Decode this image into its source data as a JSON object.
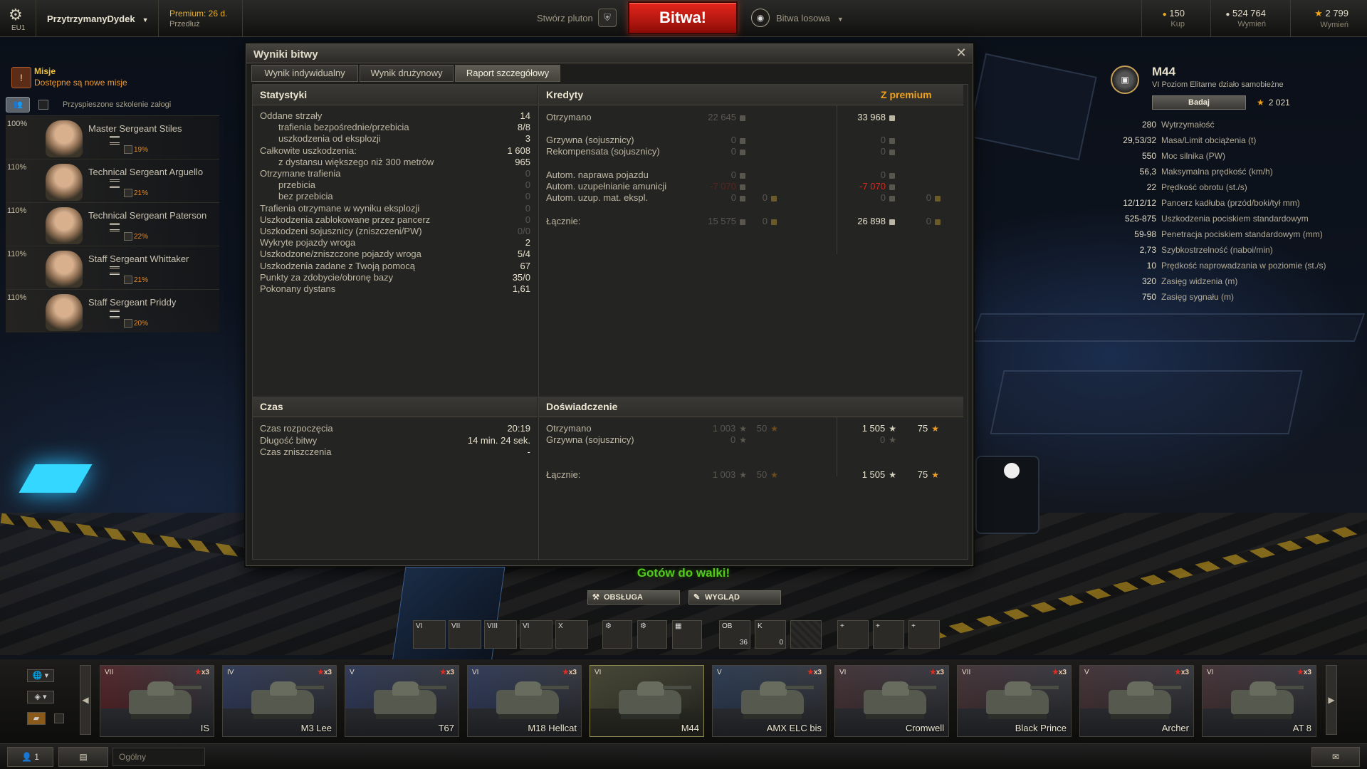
{
  "topbar": {
    "server": "EU1",
    "player_name": "PrzytrzymanyDydek",
    "premium_status": "Premium: 26 d.",
    "premium_extend": "Przedłuż",
    "create_platoon": "Stwórz pluton",
    "battle_button": "Bitwa!",
    "battle_mode": "Bitwa losowa",
    "currencies": [
      {
        "value": "150",
        "action": "Kup",
        "color": "#e8b12f"
      },
      {
        "value": "524 764",
        "action": "Wymień",
        "color": "#d9d3c1"
      },
      {
        "value": "2 799",
        "action": "Wymień",
        "color": "#f0a019"
      }
    ]
  },
  "missions": {
    "title": "Misje",
    "subtitle": "Dostępne są nowe misje"
  },
  "crew_panel": {
    "accelerated_training": "Przyspieszone szkolenie załogi",
    "members": [
      {
        "percent": "100%",
        "name": "Master Sergeant Stiles",
        "skill": "19%"
      },
      {
        "percent": "110%",
        "name": "Technical Sergeant Arguello",
        "skill": "21%"
      },
      {
        "percent": "110%",
        "name": "Technical Sergeant Paterson",
        "skill": "22%"
      },
      {
        "percent": "110%",
        "name": "Staff Sergeant Whittaker",
        "skill": "21%"
      },
      {
        "percent": "110%",
        "name": "Staff Sergeant Priddy",
        "skill": "20%"
      }
    ]
  },
  "vehicle": {
    "name": "M44",
    "type": "VI Poziom Elitarne działo samobieżne",
    "research_label": "Badaj",
    "xp": "2 021",
    "stats": [
      {
        "value": "280",
        "label": "Wytrzymałość"
      },
      {
        "value": "29,53/32",
        "label": "Masa/Limit obciążenia (t)"
      },
      {
        "value": "550",
        "label": "Moc silnika (PW)"
      },
      {
        "value": "56,3",
        "label": "Maksymalna prędkość (km/h)"
      },
      {
        "value": "22",
        "label": "Prędkość obrotu (st./s)"
      },
      {
        "value": "12/12/12",
        "label": "Pancerz kadłuba (przód/boki/tył mm)"
      },
      {
        "value": "525-875",
        "label": "Uszkodzenia pociskiem standardowym"
      },
      {
        "value": "59-98",
        "label": "Penetracja pociskiem standardowym (mm)"
      },
      {
        "value": "2,73",
        "label": "Szybkostrzelność (naboi/min)"
      },
      {
        "value": "10",
        "label": "Prędkość naprowadzania w poziomie (st./s)"
      },
      {
        "value": "320",
        "label": "Zasięg widzenia (m)"
      },
      {
        "value": "750",
        "label": "Zasięg sygnału (m)"
      }
    ]
  },
  "results": {
    "window_title": "Wyniki bitwy",
    "tabs": [
      "Wynik indywidualny",
      "Wynik drużynowy",
      "Raport szczegółowy"
    ],
    "stats": {
      "title": "Statystyki",
      "rows": [
        {
          "label": "Oddane strzały",
          "value": "14",
          "indent": false,
          "dim": false
        },
        {
          "label": "trafienia bezpośrednie/przebicia",
          "value": "8/8",
          "indent": true,
          "dim": false
        },
        {
          "label": "uszkodzenia od eksplozji",
          "value": "3",
          "indent": true,
          "dim": false
        },
        {
          "label": "Całkowite uszkodzenia:",
          "value": "1 608",
          "indent": false,
          "dim": false
        },
        {
          "label": "z dystansu większego niż 300 metrów",
          "value": "965",
          "indent": true,
          "dim": false
        },
        {
          "label": "Otrzymane trafienia",
          "value": "0",
          "indent": false,
          "dim": true
        },
        {
          "label": "przebicia",
          "value": "0",
          "indent": true,
          "dim": true
        },
        {
          "label": "bez przebicia",
          "value": "0",
          "indent": true,
          "dim": true
        },
        {
          "label": "Trafienia otrzymane w wyniku eksplozji",
          "value": "0",
          "indent": false,
          "dim": true
        },
        {
          "label": "Uszkodzenia zablokowane przez pancerz",
          "value": "0",
          "indent": false,
          "dim": true
        },
        {
          "label": "Uszkodzeni sojusznicy (zniszczeni/PW)",
          "value": "0/0",
          "indent": false,
          "dim": true
        },
        {
          "label": "Wykryte pojazdy wroga",
          "value": "2",
          "indent": false,
          "dim": false
        },
        {
          "label": "Uszkodzone/zniszczone pojazdy wroga",
          "value": "5/4",
          "indent": false,
          "dim": false
        },
        {
          "label": "Uszkodzenia zadane z Twoją pomocą",
          "value": "67",
          "indent": false,
          "dim": false
        },
        {
          "label": "Punkty za zdobycie/obronę bazy",
          "value": "35/0",
          "indent": false,
          "dim": false
        },
        {
          "label": "Pokonany dystans",
          "value": "1,61",
          "indent": false,
          "dim": false
        }
      ]
    },
    "credits": {
      "title": "Kredyty",
      "premium_header": "Z premium",
      "rows": [
        {
          "label": "Otrzymano",
          "base": "22 645",
          "bonus": "",
          "prem": "33 968",
          "prem_bonus": "",
          "base_style": "dim",
          "prem_style": "bright"
        },
        {
          "label": "Grzywna (sojusznicy)",
          "base": "0",
          "bonus": "",
          "prem": "0",
          "prem_bonus": "",
          "base_style": "dim",
          "prem_style": "dim"
        },
        {
          "label": "Rekompensata (sojusznicy)",
          "base": "0",
          "bonus": "",
          "prem": "0",
          "prem_bonus": "",
          "base_style": "dim",
          "prem_style": "dim"
        },
        {
          "label": "Autom. naprawa pojazdu",
          "base": "0",
          "bonus": "",
          "prem": "0",
          "prem_bonus": "",
          "base_style": "dim",
          "prem_style": "dim"
        },
        {
          "label": "Autom. uzupełnianie amunicji",
          "base": "-7 070",
          "bonus": "",
          "prem": "-7 070",
          "prem_bonus": "",
          "base_style": "reddim",
          "prem_style": "red"
        },
        {
          "label": "Autom. uzup. mat. ekspl.",
          "base": "0",
          "bonus": "0",
          "prem": "0",
          "prem_bonus": "0",
          "base_style": "dim",
          "prem_style": "dim"
        },
        {
          "label": "Łącznie:",
          "base": "15 575",
          "bonus": "0",
          "prem": "26 898",
          "prem_bonus": "0",
          "base_style": "dim",
          "prem_style": "bright"
        }
      ]
    },
    "time": {
      "title": "Czas",
      "rows": [
        {
          "label": "Czas rozpoczęcia",
          "value": "20:19"
        },
        {
          "label": "Długość bitwy",
          "value": "14 min. 24 sek."
        },
        {
          "label": "Czas zniszczenia",
          "value": "-"
        }
      ]
    },
    "experience": {
      "title": "Doświadczenie",
      "rows": [
        {
          "label": "Otrzymano",
          "base": "1 003",
          "free": "50",
          "prem": "1 505",
          "prem_free": "75",
          "prem_style": "bright"
        },
        {
          "label": "Grzywna (sojusznicy)",
          "base": "0",
          "free": "",
          "prem": "0",
          "prem_free": "",
          "prem_style": "dim"
        },
        {
          "label": "Łącznie:",
          "base": "1 003",
          "free": "50",
          "prem": "1 505",
          "prem_free": "75",
          "prem_style": "bright"
        }
      ]
    }
  },
  "hangar": {
    "ready": "Gotów do walki!",
    "service": "OBSŁUGA",
    "appearance": "WYGLĄD",
    "modules": [
      "VI",
      "VII",
      "VIII",
      "VI",
      "X"
    ],
    "ammo": [
      {
        "tag": "OB",
        "count": "36"
      },
      {
        "tag": "K",
        "count": "0"
      }
    ]
  },
  "carousel": {
    "tanks": [
      {
        "tier": "VII",
        "name": "IS",
        "crew": "x3",
        "flag": "#7a1010",
        "selected": false
      },
      {
        "tier": "IV",
        "name": "M3 Lee",
        "crew": "x3",
        "flag": "#2c3f7a",
        "selected": false
      },
      {
        "tier": "V",
        "name": "T67",
        "crew": "x3",
        "flag": "#2c3f7a",
        "selected": false
      },
      {
        "tier": "VI",
        "name": "M18 Hellcat",
        "crew": "x3",
        "flag": "#2c3f7a",
        "selected": false
      },
      {
        "tier": "VI",
        "name": "M44",
        "crew": "",
        "flag": "#5a5a40",
        "selected": true
      },
      {
        "tier": "V",
        "name": "AMX ELC bis",
        "crew": "x3",
        "flag": "#23416b",
        "selected": false
      },
      {
        "tier": "VI",
        "name": "Cromwell",
        "crew": "x3",
        "flag": "#5a2f2f",
        "selected": false
      },
      {
        "tier": "VII",
        "name": "Black Prince",
        "crew": "x3",
        "flag": "#5a2f2f",
        "selected": false
      },
      {
        "tier": "V",
        "name": "Archer",
        "crew": "x3",
        "flag": "#5a2f2f",
        "selected": false
      },
      {
        "tier": "VI",
        "name": "AT 8",
        "crew": "x3",
        "flag": "#5a2f2f",
        "selected": false
      }
    ]
  },
  "bottombar": {
    "friends_count": "1",
    "channel": "Ogólny"
  }
}
